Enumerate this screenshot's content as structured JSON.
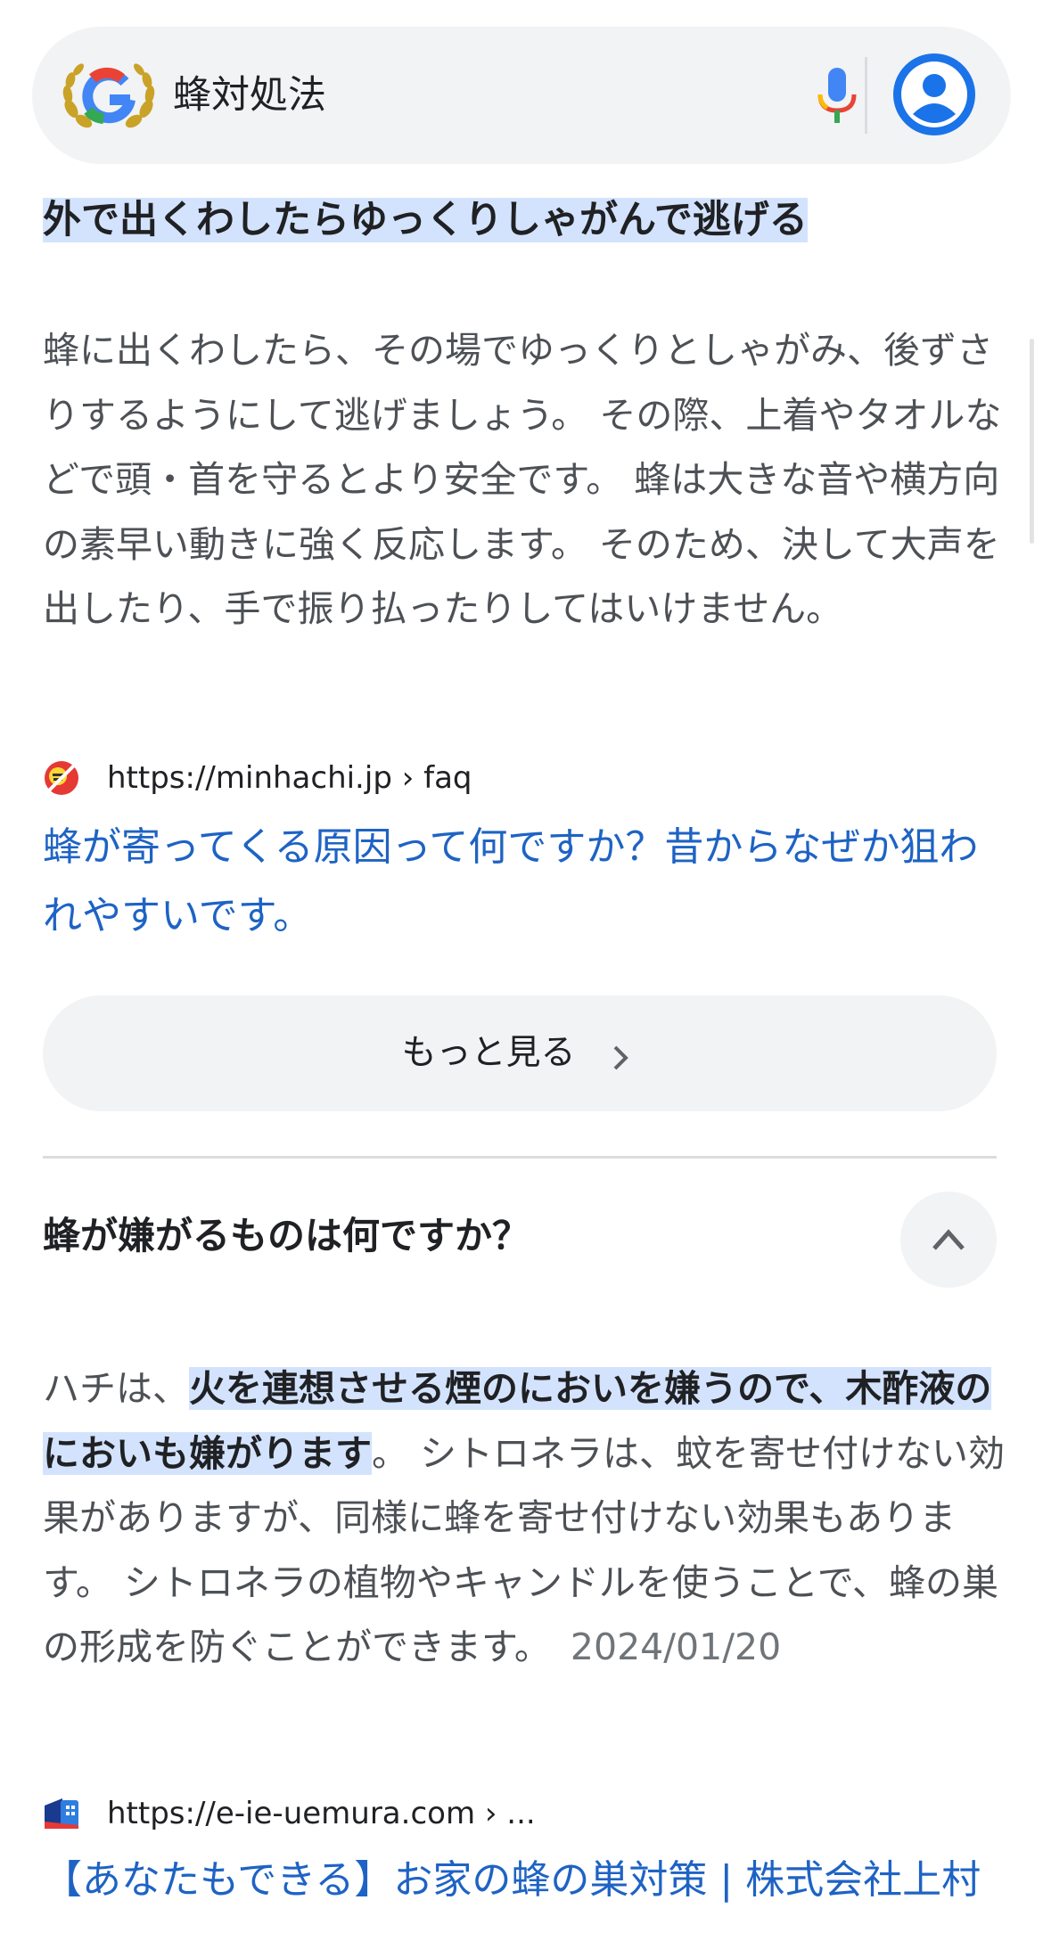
{
  "search": {
    "query": "蜂対処法",
    "logo_icon": "google-g-laurel-logo",
    "mic_icon": "mic-icon",
    "account_icon": "account-circle-icon"
  },
  "result1": {
    "heading": "外で出くわしたらゆっくりしゃがんで逃げる",
    "paragraph": "蜂に出くわしたら、その場でゆっくりとしゃがみ、後ずさりするようにして逃げましょう。 その際、上着やタオルなどで頭・首を守るとより安全です。 蜂は大きな音や横方向の素早い動きに強く反応します。 そのため、決して大声を出したり、手で振り払ったりしてはいけません。",
    "source_url": "https://minhachi.jp › faq",
    "link_title": "蜂が寄ってくる原因って何ですか？昔からなぜか狙われやすいです。"
  },
  "more_button": {
    "label": "もっと見る"
  },
  "question": {
    "title": "蜂が嫌がるものは何ですか？",
    "answer_prefix": "ハチは、",
    "answer_highlight": "火を連想させる煙のにおいを嫌うので、木酢液のにおいも嫌がります",
    "answer_rest": "。 シトロネラは、蚊を寄せ付けない効果がありますが、同様に蜂を寄せ付けない効果もあります。 シトロネラの植物やキャンドルを使うことで、蜂の巣の形成を防ぐことができます。",
    "date": "2024/01/20",
    "source_url": "https://e-ie-uemura.com › ...",
    "link_title": "【あなたもできる】お家の蜂の巣対策 | 株式会社上村"
  },
  "colors": {
    "highlight": "#d3e3fd",
    "link": "#1e63c4",
    "chip_bg": "#f1f3f4"
  }
}
